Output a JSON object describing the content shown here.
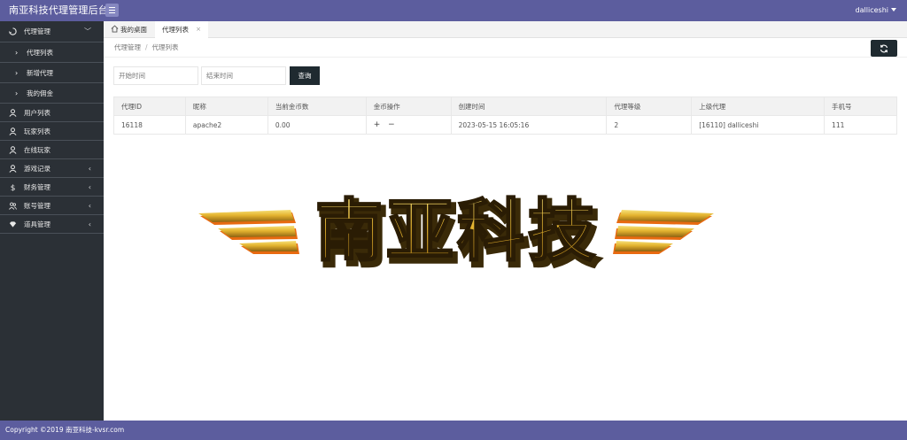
{
  "header": {
    "title": "南亚科技代理管理后台",
    "user": "dalliceshi"
  },
  "sidebar": {
    "group": {
      "label": "代理管理",
      "icon": "recycle-icon"
    },
    "subitems": [
      "代理列表",
      "新增代理",
      "我的佣金"
    ],
    "items": [
      {
        "label": "用户列表",
        "icon": "user-icon"
      },
      {
        "label": "玩家列表",
        "icon": "user-icon"
      },
      {
        "label": "在线玩家",
        "icon": "user-icon"
      },
      {
        "label": "游戏记录",
        "icon": "user-icon"
      },
      {
        "label": "财务管理",
        "icon": "dollar-icon"
      },
      {
        "label": "账号管理",
        "icon": "users-icon"
      },
      {
        "label": "道具管理",
        "icon": "diamond-icon"
      }
    ]
  },
  "tabs": {
    "home": "我的桌面",
    "active": "代理列表",
    "close": "×"
  },
  "breadcrumb": {
    "parent": "代理管理",
    "separator": "/",
    "current": "代理列表"
  },
  "filters": {
    "start_placeholder": "开始时间",
    "end_placeholder": "结束时间",
    "query_label": "查询"
  },
  "table": {
    "columns": [
      "代理ID",
      "昵称",
      "当前金币数",
      "金币操作",
      "创建时间",
      "代理等级",
      "上级代理",
      "手机号"
    ],
    "rows": [
      [
        "16118",
        "apache2",
        "0.00",
        "+ −",
        "2023-05-15 16:05:16",
        "2",
        "[16110] dalliceshi",
        "111"
      ]
    ]
  },
  "logo": {
    "text": "南亚科技"
  },
  "footer": {
    "copyright": "Copyright ©2019 南亚科技-kvsr.com"
  },
  "colors": {
    "accent": "#5c5d9e",
    "sidebar": "#2b3036",
    "button_dark": "#1f2a30",
    "logo_gold": "#e8b830",
    "logo_orange": "#e86a10"
  }
}
